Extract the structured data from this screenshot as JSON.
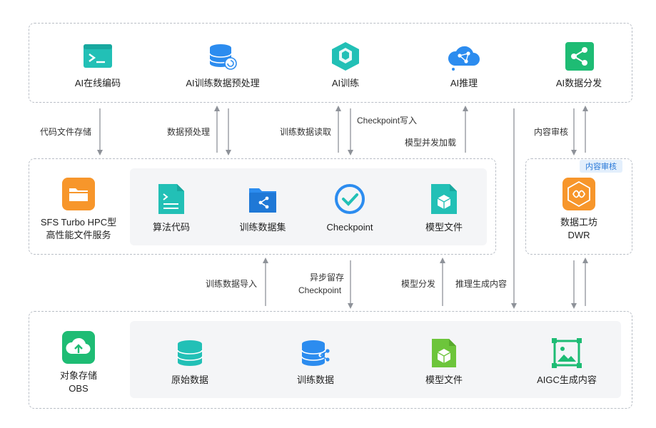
{
  "top": {
    "items": [
      {
        "label": "AI在线编码",
        "icon": "terminal-icon"
      },
      {
        "label": "AI训练数据预处理",
        "icon": "database-refresh-icon"
      },
      {
        "label": "AI训练",
        "icon": "hexagon-network-icon"
      },
      {
        "label": "AI推理",
        "icon": "cloud-network-icon"
      },
      {
        "label": "AI数据分发",
        "icon": "share-nodes-icon"
      }
    ]
  },
  "sfs": {
    "title_line1": "SFS Turbo HPC型",
    "title_line2": "高性能文件服务",
    "items": [
      {
        "label": "算法代码",
        "icon": "code-file-icon"
      },
      {
        "label": "训练数据集",
        "icon": "folder-share-icon"
      },
      {
        "label": "Checkpoint",
        "icon": "check-circle-icon"
      },
      {
        "label": "模型文件",
        "icon": "model-file-icon"
      }
    ]
  },
  "dwr": {
    "tag": "内容审核",
    "line1": "数据工坊",
    "line2": "DWR",
    "icon": "workshop-icon"
  },
  "obs": {
    "title_line1": "对象存储",
    "title_line2": "OBS",
    "items": [
      {
        "label": "原始数据",
        "icon": "database-icon"
      },
      {
        "label": "训练数据",
        "icon": "database-share-icon"
      },
      {
        "label": "模型文件",
        "icon": "model-file-icon"
      },
      {
        "label": "AIGC生成内容",
        "icon": "image-frame-icon"
      }
    ]
  },
  "edges": {
    "code_store": "代码文件存储",
    "preprocess": "数据预处理",
    "train_read": "训练数据读取",
    "ckpt_write": "Checkpoint写入",
    "model_load": "模型并发加载",
    "review": "内容审核",
    "import_data": "训练数据导入",
    "async_ckpt_1": "异步留存",
    "async_ckpt_2": "Checkpoint",
    "model_dist": "模型分发",
    "infer_gen": "推理生成内容"
  },
  "colors": {
    "green": "#1ebc74",
    "blue": "#2c8cef",
    "teal": "#22c0b6",
    "orange": "#f7962b",
    "arrow": "#8e9299"
  }
}
